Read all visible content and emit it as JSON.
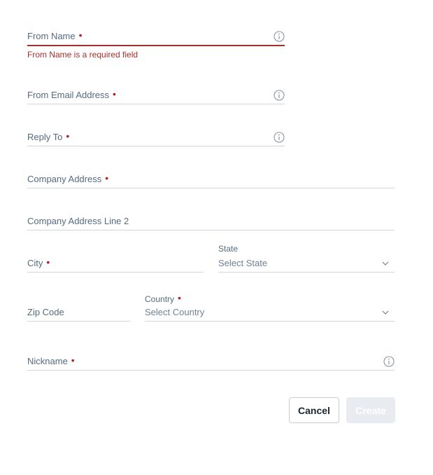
{
  "form": {
    "from_name": {
      "label": "From Name",
      "required_mark": "•",
      "error": "From Name is a required field"
    },
    "from_email": {
      "label": "From Email Address",
      "required_mark": "•"
    },
    "reply_to": {
      "label": "Reply To",
      "required_mark": "•"
    },
    "company_address": {
      "label": "Company Address",
      "required_mark": "•"
    },
    "company_address_2": {
      "label": "Company Address Line 2"
    },
    "city": {
      "label": "City",
      "required_mark": "•"
    },
    "state": {
      "label": "State",
      "placeholder": "Select State"
    },
    "zip": {
      "label": "Zip Code"
    },
    "country": {
      "label": "Country",
      "required_mark": "•",
      "placeholder": "Select Country"
    },
    "nickname": {
      "label": "Nickname",
      "required_mark": "•"
    }
  },
  "actions": {
    "cancel_label": "Cancel",
    "create_label": "Create"
  },
  "colors": {
    "error": "#a82d2d",
    "required": "#b22222",
    "border": "#d1d6db",
    "disabled_bg": "#e8ebef"
  },
  "icons": {
    "info": "info-circle-icon",
    "chevron": "chevron-down-icon"
  }
}
